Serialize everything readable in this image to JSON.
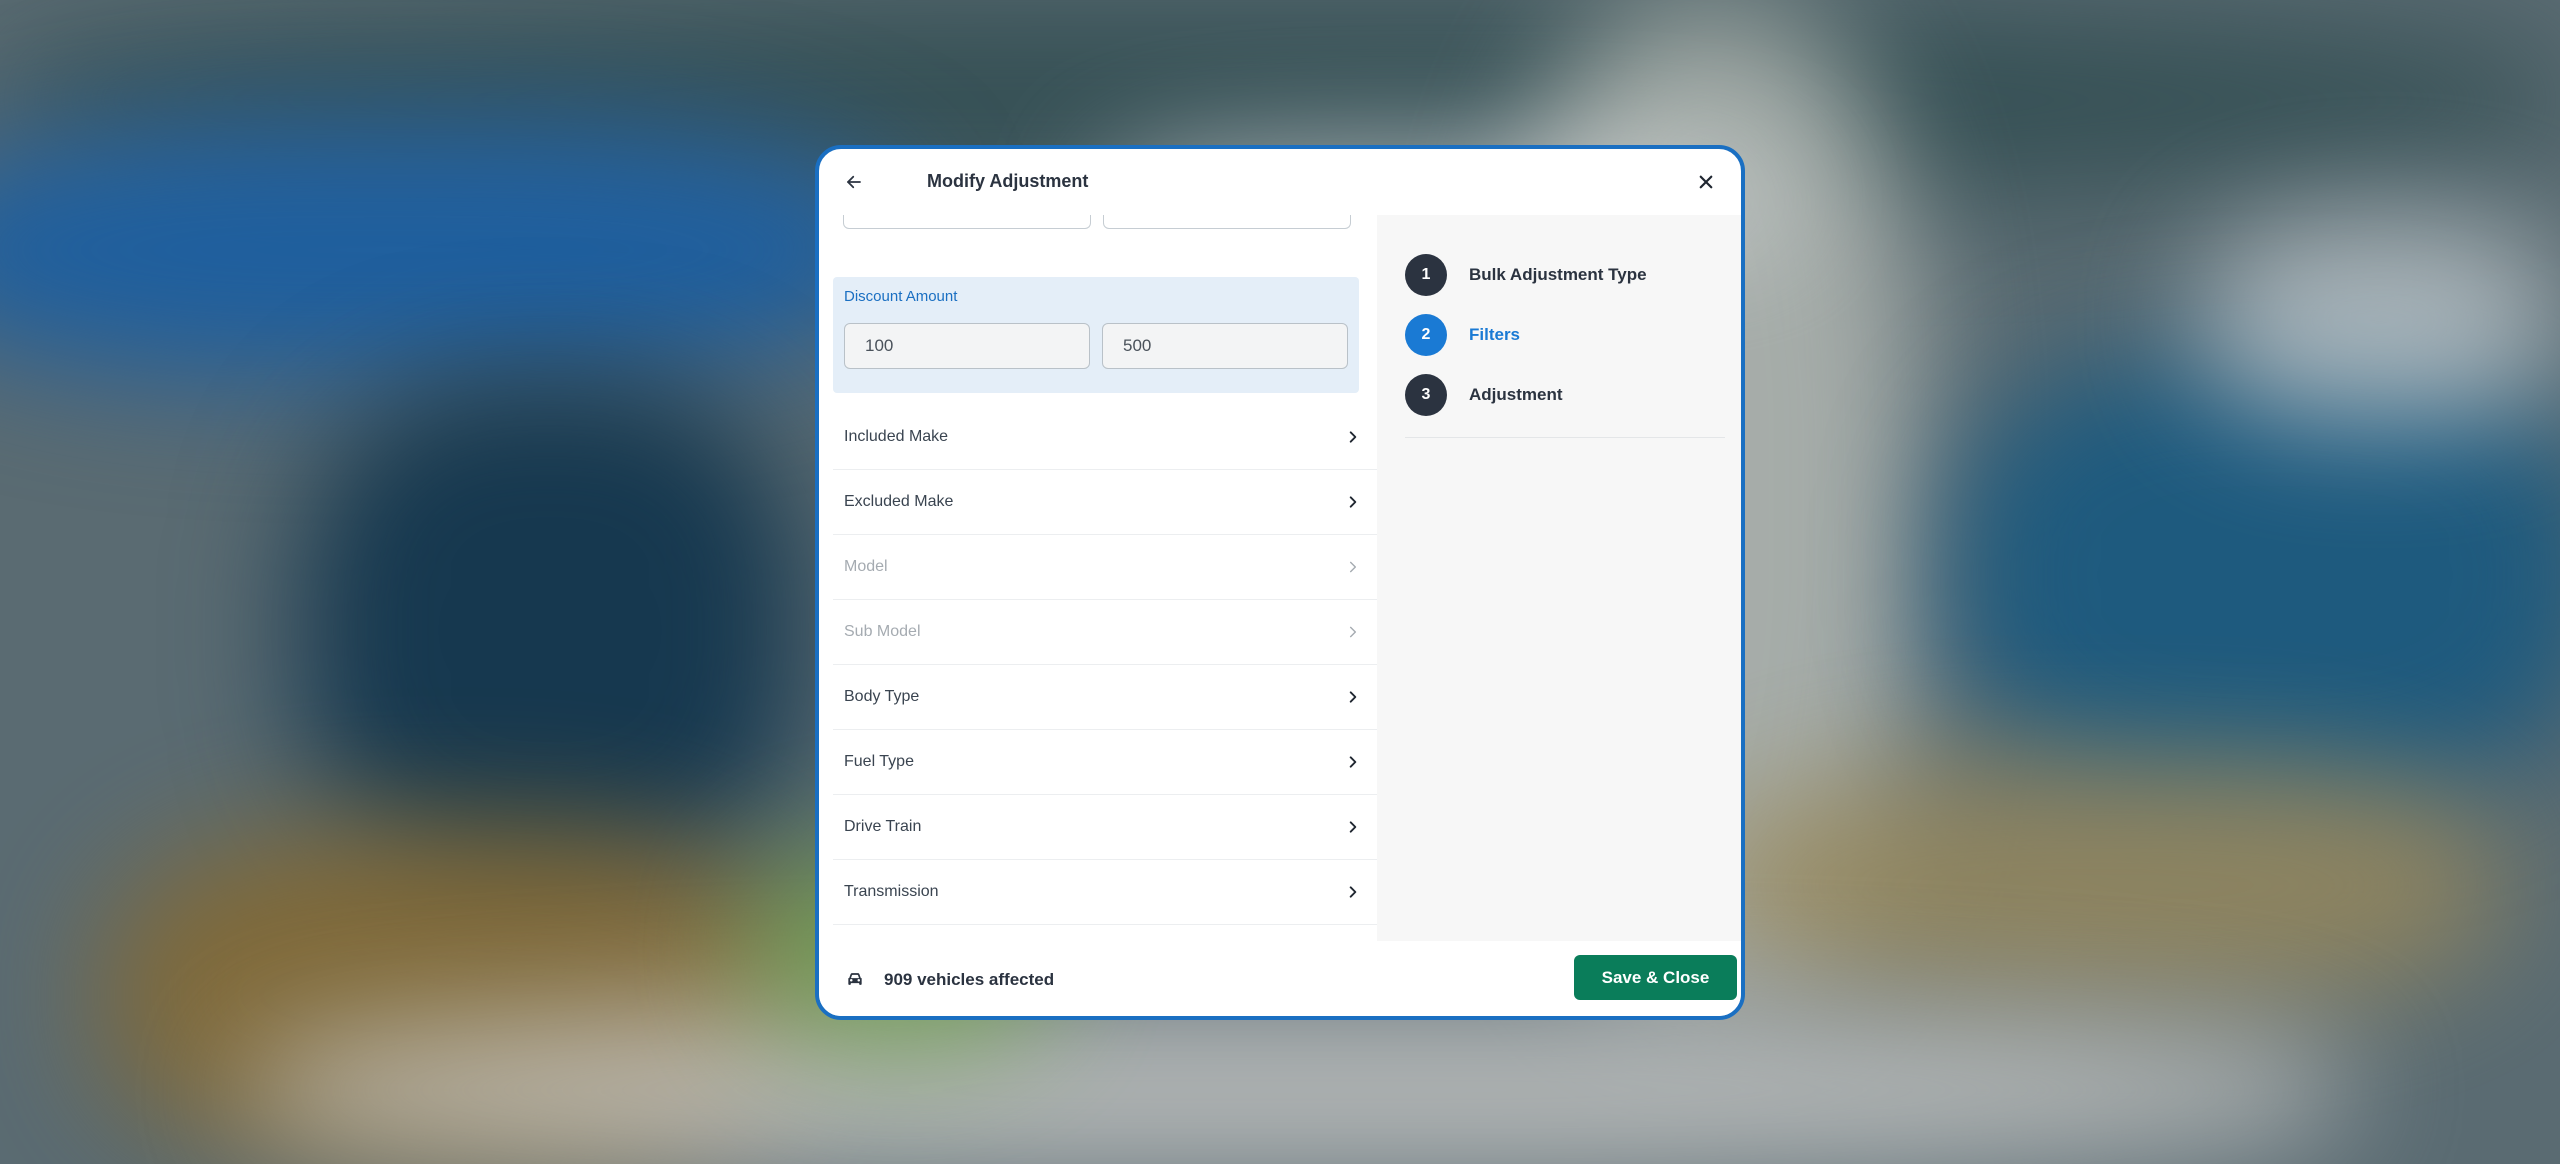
{
  "header": {
    "title": "Modify Adjustment"
  },
  "discount": {
    "label": "Discount Amount",
    "min_value": "100",
    "max_value": "500"
  },
  "filters": [
    {
      "label": "Included Make",
      "disabled": false
    },
    {
      "label": "Excluded Make",
      "disabled": false
    },
    {
      "label": "Model",
      "disabled": true
    },
    {
      "label": "Sub Model",
      "disabled": true
    },
    {
      "label": "Body Type",
      "disabled": false
    },
    {
      "label": "Fuel Type",
      "disabled": false
    },
    {
      "label": "Drive Train",
      "disabled": false
    },
    {
      "label": "Transmission",
      "disabled": false
    }
  ],
  "steps": [
    {
      "number": "1",
      "label": "Bulk Adjustment Type",
      "active": false
    },
    {
      "number": "2",
      "label": "Filters",
      "active": true
    },
    {
      "number": "3",
      "label": "Adjustment",
      "active": false
    }
  ],
  "footer": {
    "affected_text": "909 vehicles affected",
    "save_label": "Save & Close"
  },
  "colors": {
    "accent": "#1a6fc2",
    "step_active": "#1a7ad4",
    "save_button": "#0a7d5a",
    "dark": "#2b3340"
  },
  "icons": {
    "back": "arrow-left-icon",
    "close": "close-icon",
    "chevron": "chevron-right-icon",
    "car": "car-icon"
  }
}
